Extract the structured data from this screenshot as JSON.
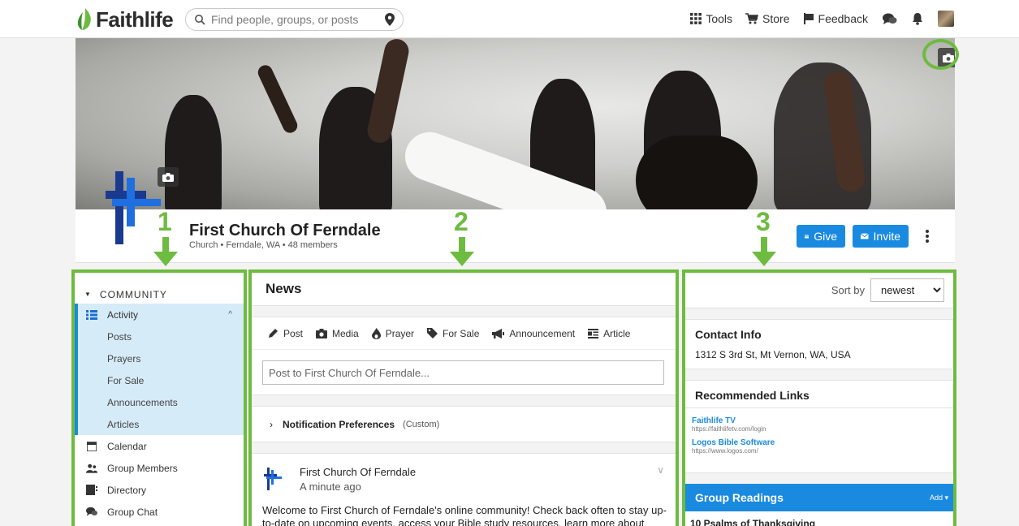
{
  "brand": {
    "name": "Faithlife"
  },
  "search": {
    "placeholder": "Find people, groups, or posts"
  },
  "topnav": {
    "tools": "Tools",
    "store": "Store",
    "feedback": "Feedback"
  },
  "group": {
    "name": "First Church Of Ferndale",
    "meta": "Church • Ferndale, WA • 48 members",
    "give": "Give",
    "invite": "Invite"
  },
  "annotations": [
    "1",
    "2",
    "3"
  ],
  "sidebar": {
    "section": "COMMUNITY",
    "items": [
      {
        "label": "Activity",
        "icon": "activity-icon"
      },
      {
        "label": "Posts"
      },
      {
        "label": "Prayers"
      },
      {
        "label": "For Sale"
      },
      {
        "label": "Announcements"
      },
      {
        "label": "Articles"
      },
      {
        "label": "Calendar",
        "icon": "calendar-icon"
      },
      {
        "label": "Group Members",
        "icon": "members-icon"
      },
      {
        "label": "Directory",
        "icon": "directory-icon"
      },
      {
        "label": "Group Chat",
        "icon": "chat-icon"
      }
    ]
  },
  "news": {
    "title": "News",
    "post_types": [
      "Post",
      "Media",
      "Prayer",
      "For Sale",
      "Announcement",
      "Article"
    ],
    "post_placeholder": "Post to First Church Of Ferndale...",
    "notif_label": "Notification Preferences",
    "notif_value": "(Custom)",
    "feed_author": "First Church Of Ferndale",
    "feed_time": "A minute ago",
    "feed_text": "Welcome to First Church of Ferndale's online community! Check back often to stay up-to-date on upcoming events, access your Bible study resources, learn more about"
  },
  "right": {
    "sort_label": "Sort by",
    "sort_value": "newest",
    "contact_title": "Contact Info",
    "contact_address": "1312 S 3rd St, Mt Vernon, WA, USA",
    "links_title": "Recommended Links",
    "links": [
      {
        "title": "Faithlife TV",
        "url": "https://faithlifetv.com/login"
      },
      {
        "title": "Logos Bible Software",
        "url": "https://www.logos.com/"
      }
    ],
    "readings_title": "Group Readings",
    "readings_add": "Add ▾",
    "reading_first": "10 Psalms of Thanksgiving"
  },
  "colors": {
    "accent": "#1a8ae0",
    "annotation": "#6dbb3f",
    "logo_leaf": "#6dbb3f"
  }
}
